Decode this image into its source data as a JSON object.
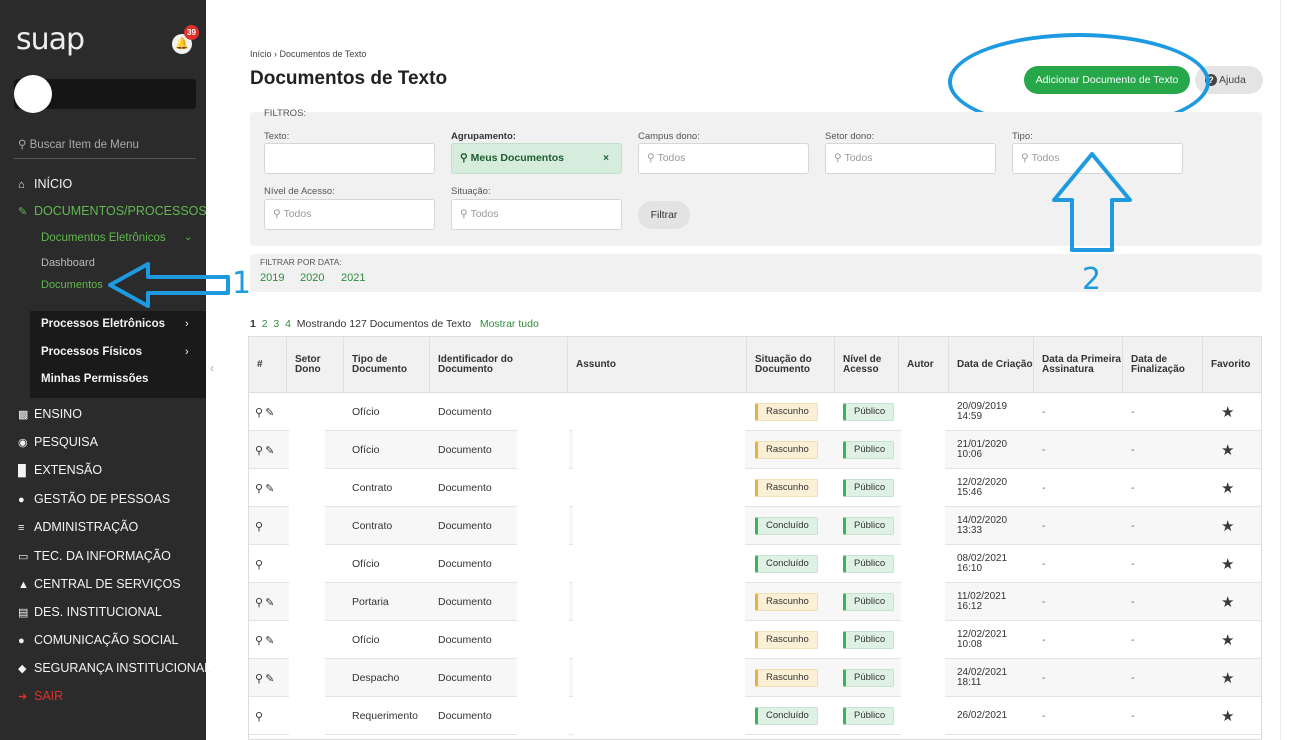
{
  "app": {
    "logo": "suap",
    "notifications": "39"
  },
  "sidebar": {
    "search_placeholder": "Buscar Item de Menu",
    "items": [
      {
        "icon": "home-icon",
        "label": "INÍCIO"
      },
      {
        "icon": "documents-icon",
        "label": "DOCUMENTOS/PROCESSOS"
      },
      {
        "icon": "teaching-icon",
        "label": "ENSINO"
      },
      {
        "icon": "research-icon",
        "label": "PESQUISA"
      },
      {
        "icon": "extension-icon",
        "label": "EXTENSÃO"
      },
      {
        "icon": "people-icon",
        "label": "GESTÃO DE PESSOAS"
      },
      {
        "icon": "admin-icon",
        "label": "ADMINISTRAÇÃO"
      },
      {
        "icon": "monitor-icon",
        "label": "TEC. DA INFORMAÇÃO"
      },
      {
        "icon": "services-icon",
        "label": "CENTRAL DE SERVIÇOS"
      },
      {
        "icon": "chart-icon",
        "label": "DES. INSTITUCIONAL"
      },
      {
        "icon": "chat-icon",
        "label": "COMUNICAÇÃO SOCIAL"
      },
      {
        "icon": "shield-icon",
        "label": "SEGURANÇA INSTITUCIONAL"
      },
      {
        "icon": "logout-icon",
        "label": "SAIR"
      }
    ],
    "submenu": {
      "header": "Documentos Eletrônicos",
      "items": [
        "Dashboard",
        "Documentos"
      ],
      "groups": [
        "Processos Eletrônicos",
        "Processos Físicos",
        "Minhas Permissões"
      ]
    }
  },
  "header": {
    "breadcrumb": [
      "Início",
      "Documentos de Texto"
    ],
    "title": "Documentos de Texto",
    "add_button": "Adicionar Documento de Texto",
    "help_button": "Ajuda"
  },
  "filters": {
    "section_label": "FILTROS:",
    "texto_label": "Texto:",
    "agrupamento_label": "Agrupamento:",
    "agrupamento_value": "Meus Documentos",
    "campus_label": "Campus dono:",
    "setor_label": "Setor dono:",
    "tipo_label": "Tipo:",
    "nivel_label": "Nível de Acesso:",
    "situacao_label": "Situação:",
    "todos": "Todos",
    "filter_button": "Filtrar"
  },
  "date_filter": {
    "label": "FILTRAR POR DATA:",
    "years": [
      "2019",
      "2020",
      "2021"
    ]
  },
  "pagination": {
    "pages": [
      "1",
      "2",
      "3",
      "4"
    ],
    "summary": "Mostrando 127 Documentos de Texto",
    "show_all": "Mostrar tudo"
  },
  "table": {
    "columns": [
      "#",
      "Setor Dono",
      "Tipo de Documento",
      "Identificador do Documento",
      "Assunto",
      "Situação do Documento",
      "Nível de Acesso",
      "Autor",
      "Data de Criação",
      "Data da Primeira Assinatura",
      "Data de Finalização",
      "Favorito"
    ],
    "rows": [
      {
        "tipo": "Ofício",
        "id": "Documento",
        "situacao": "Rascunho",
        "nivel": "Público",
        "data": "20/09/2019 14:59",
        "first": "-",
        "final": "-",
        "edit": true
      },
      {
        "tipo": "Ofício",
        "id": "Documento",
        "situacao": "Rascunho",
        "nivel": "Público",
        "data": "21/01/2020 10:06",
        "first": "-",
        "final": "-",
        "edit": true
      },
      {
        "tipo": "Contrato",
        "id": "Documento",
        "situacao": "Rascunho",
        "nivel": "Público",
        "data": "12/02/2020 15:46",
        "first": "-",
        "final": "-",
        "edit": true
      },
      {
        "tipo": "Contrato",
        "id": "Documento",
        "situacao": "Concluído",
        "nivel": "Público",
        "data": "14/02/2020 13:33",
        "first": "-",
        "final": "-",
        "edit": false
      },
      {
        "tipo": "Ofício",
        "id": "Documento",
        "situacao": "Concluído",
        "nivel": "Público",
        "data": "08/02/2021 16:10",
        "first": "-",
        "final": "-",
        "edit": false
      },
      {
        "tipo": "Portaria",
        "id": "Documento",
        "situacao": "Rascunho",
        "nivel": "Público",
        "data": "11/02/2021 16:12",
        "first": "-",
        "final": "-",
        "edit": true
      },
      {
        "tipo": "Ofício",
        "id": "Documento",
        "situacao": "Rascunho",
        "nivel": "Público",
        "data": "12/02/2021 10:08",
        "first": "-",
        "final": "-",
        "edit": true
      },
      {
        "tipo": "Despacho",
        "id": "Documento",
        "situacao": "Rascunho",
        "nivel": "Público",
        "data": "24/02/2021 18:11",
        "first": "-",
        "final": "-",
        "edit": true
      },
      {
        "tipo": "Requerimento",
        "id": "Documento",
        "situacao": "Concluído",
        "nivel": "Público",
        "data": "26/02/2021",
        "first": "-",
        "final": "-",
        "edit": false
      }
    ]
  },
  "annotations": {
    "label_1": "1",
    "label_2": "2",
    "color": "#1e9be0"
  },
  "colors": {
    "sidebar_bg": "#2b2b2b",
    "accent_green": "#26a74a",
    "link_green": "#2e8b3d",
    "annotation_blue": "#1e9be0"
  }
}
